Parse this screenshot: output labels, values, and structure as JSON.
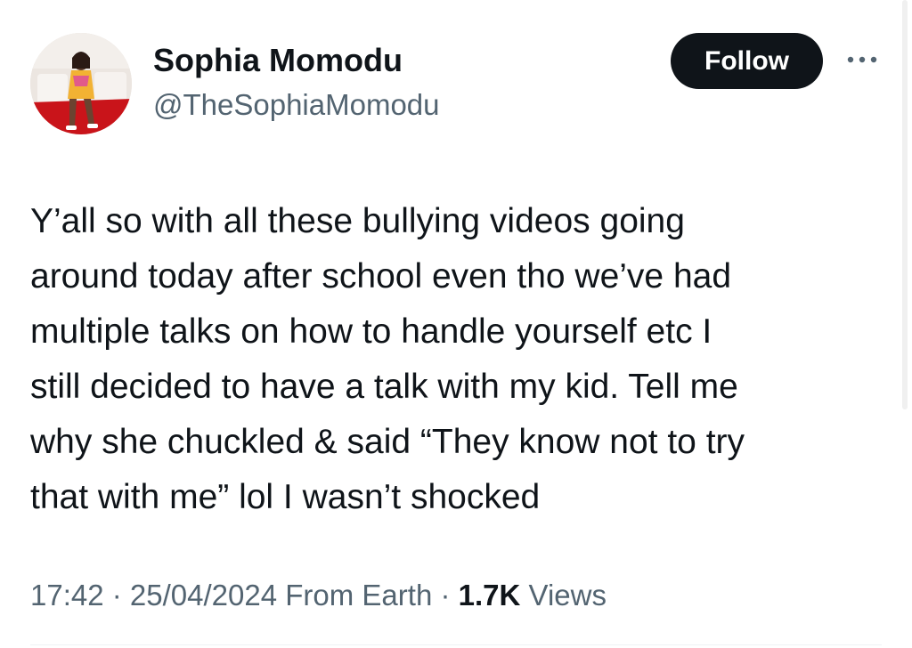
{
  "author": {
    "display_name": "Sophia Momodu",
    "handle": "@TheSophiaMomodu"
  },
  "actions": {
    "follow_label": "Follow",
    "more_icon": "more-horizontal-icon"
  },
  "tweet": {
    "text": "Y’all so with all these bullying videos going\naround today after school even tho we’ve had\nmultiple talks on how to handle yourself etc I\nstill decided to have a talk with my kid. Tell me\nwhy she chuckled & said “They know not to try\nthat with me” lol I wasn’t shocked",
    "time": "17:42",
    "date": "25/04/2024",
    "source": "From Earth",
    "views_count": "1.7K",
    "views_label": "Views",
    "separator": " · "
  },
  "colors": {
    "text_primary": "#0f1419",
    "text_secondary": "#536471",
    "follow_bg": "#0f1419",
    "follow_text": "#ffffff"
  }
}
